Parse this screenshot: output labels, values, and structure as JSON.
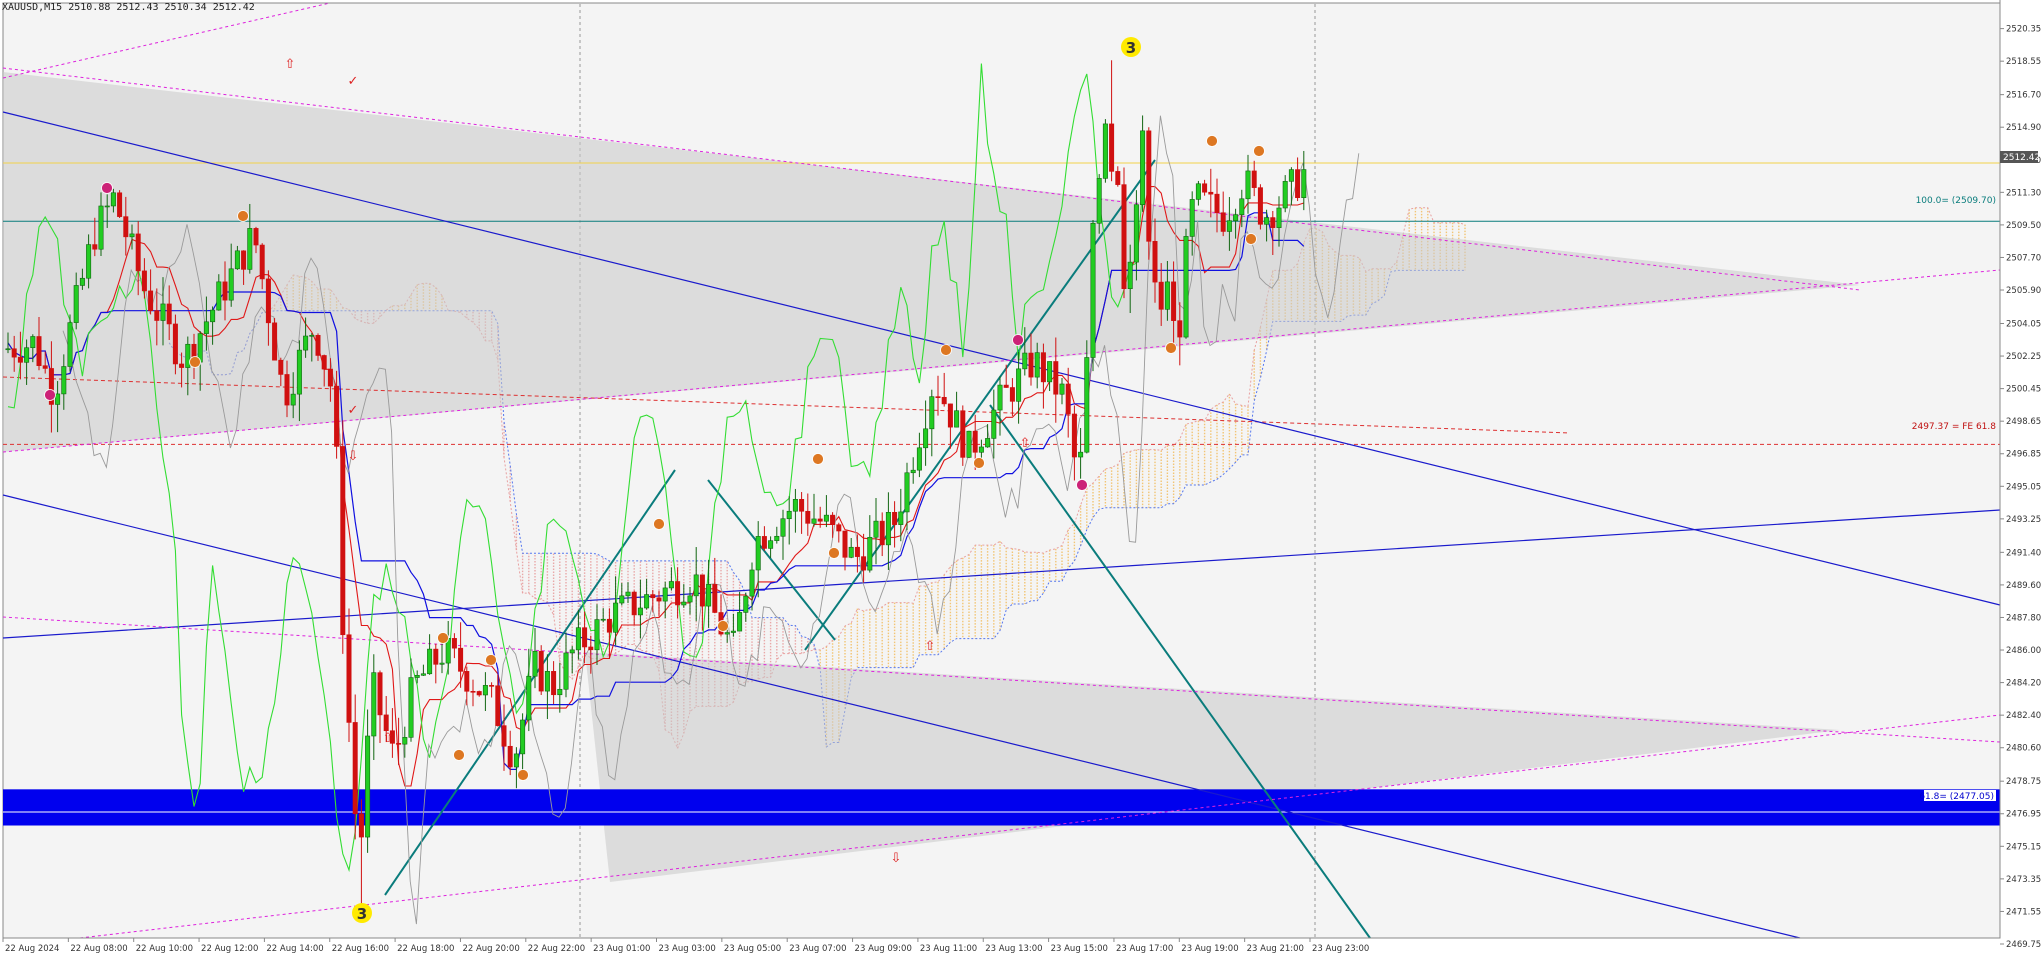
{
  "header": {
    "symbol": "XAUUSD,M15",
    "open": "2510.88",
    "high": "2512.43",
    "low": "2510.34",
    "close": "2512.42"
  },
  "price_tag": "2512.42",
  "fib_labels": {
    "top": "100.0= (2509.70)",
    "mid": "2497.37 = FE 61.8",
    "bottom": "61.8= (2477.05)"
  },
  "wave_labels": {
    "high": "3",
    "low": "3"
  },
  "colors": {
    "bull": "#22cc22",
    "bear": "#d01010",
    "tenkan": "#e01818",
    "kijun": "#1010e0",
    "chikou": "#33dd33",
    "zone": "#0000ee",
    "trend_blue": "#1a1acc",
    "trend_teal": "#0a7c7c",
    "magenta": "#dd22dd",
    "level_yellow": "#f2d24a",
    "wave_marker": "#ffea00"
  },
  "chart_data": {
    "type": "candlestick",
    "title": "",
    "symbol": "XAUUSD",
    "timeframe": "M15",
    "ylim": [
      2469.75,
      2521.6
    ],
    "y_ticks": [
      "2520.35",
      "2518.55",
      "2516.70",
      "2514.90",
      "2513.10",
      "2511.30",
      "2509.50",
      "2507.70",
      "2505.90",
      "2504.05",
      "2502.25",
      "2500.45",
      "2498.65",
      "2496.85",
      "2495.05",
      "2493.25",
      "2491.40",
      "2489.60",
      "2487.80",
      "2486.00",
      "2484.20",
      "2482.40",
      "2480.60",
      "2478.75",
      "2476.95",
      "2475.15",
      "2473.35",
      "2471.55",
      "2469.75"
    ],
    "x_ticks": [
      "22 Aug 2024",
      "22 Aug 08:00",
      "22 Aug 10:00",
      "22 Aug 12:00",
      "22 Aug 14:00",
      "22 Aug 16:00",
      "22 Aug 18:00",
      "22 Aug 20:00",
      "22 Aug 22:00",
      "23 Aug 01:00",
      "23 Aug 03:00",
      "23 Aug 05:00",
      "23 Aug 07:00",
      "23 Aug 09:00",
      "23 Aug 11:00",
      "23 Aug 13:00",
      "23 Aug 15:00",
      "23 Aug 17:00",
      "23 Aug 19:00",
      "23 Aug 21:00",
      "23 Aug 23:00"
    ],
    "current_price": 2512.42,
    "levels": {
      "fib_100": 2509.7,
      "fe_61_8": 2497.37,
      "fib_61_8": 2477.05
    },
    "support_zone": [
      2476.3,
      2478.3
    ],
    "wave_3_high": 2518.6,
    "wave_3_low": 2471.2
  }
}
